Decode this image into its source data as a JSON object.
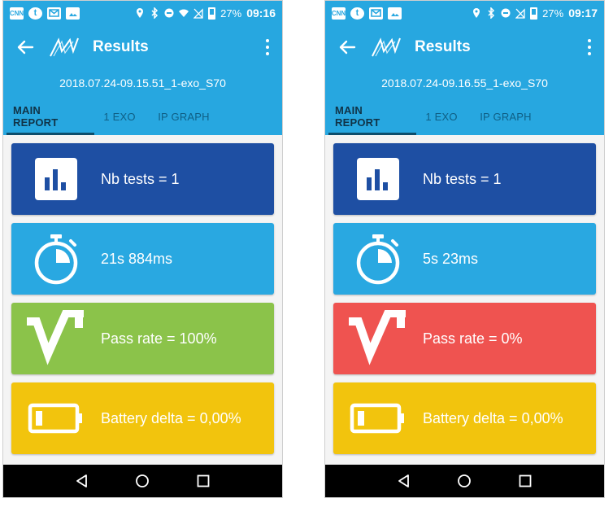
{
  "colors": {
    "primary": "#27a7e0",
    "tests_card": "#1e4fa3",
    "time_card": "#29a8e1",
    "pass_ok": "#8bc34a",
    "pass_fail": "#ef5350",
    "battery_card": "#f2c40d"
  },
  "screens": [
    {
      "status": {
        "battery_pct": "27%",
        "time": "09:16",
        "icon_labels": [
          "CNN",
          "t"
        ]
      },
      "title": "Results",
      "filename": "2018.07.24-09.15.51_1-exo_S70",
      "tabs": [
        "MAIN REPORT",
        "1 EXO",
        "IP GRAPH"
      ],
      "cards": {
        "tests": "Nb tests = 1",
        "duration": "21s 884ms",
        "pass": "Pass rate = 100%",
        "battery": "Battery delta = 0,00%"
      },
      "pass_state": "pass"
    },
    {
      "status": {
        "battery_pct": "27%",
        "time": "09:17",
        "icon_labels": [
          "CNN",
          "t"
        ]
      },
      "title": "Results",
      "filename": "2018.07.24-09.16.55_1-exo_S70",
      "tabs": [
        "MAIN REPORT",
        "1 EXO",
        "IP GRAPH"
      ],
      "cards": {
        "tests": "Nb tests = 1",
        "duration": "5s 23ms",
        "pass": "Pass rate = 0%",
        "battery": "Battery delta = 0,00%"
      },
      "pass_state": "fail"
    }
  ]
}
